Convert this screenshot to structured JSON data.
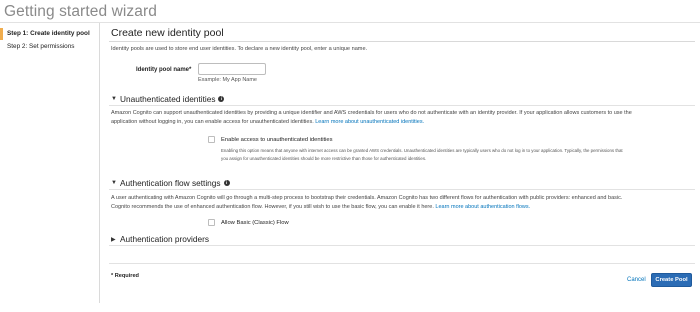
{
  "wizard_title": "Getting started wizard",
  "sidebar": {
    "steps": [
      {
        "label": "Step 1: Create identity pool",
        "active": true
      },
      {
        "label": "Step 2: Set permissions",
        "active": false
      }
    ]
  },
  "main": {
    "title": "Create new identity pool",
    "intro": "Identity pools are used to store end user identities. To declare a new identity pool, enter a unique name.",
    "pool_name": {
      "label": "Identity pool name*",
      "value": "",
      "hint": "Example: My App Name"
    },
    "unauth": {
      "heading": "Unauthenticated identities",
      "desc_line1": "Amazon Cognito can support unauthenticated identities by providing a unique identifier and AWS credentials for users who do not authenticate with an identity provider. If your application allows customers to use the",
      "desc_line2": "application without logging in, you can enable access for unauthenticated identities.",
      "desc_link": "Learn more about unauthenticated identities.",
      "checkbox_label": "Enable access to unauthenticated identities",
      "checkbox_checked": false,
      "checkbox_desc_line1": "Enabling this option means that anyone with internet access can be granted AWS credentials. Unauthenticated identities are typically users who do not log in to your application. Typically, the permissions that",
      "checkbox_desc_line2": "you assign for unauthenticated identities should be more restrictive than those for authenticated identities."
    },
    "auth_flow": {
      "heading": "Authentication flow settings",
      "desc_line1": "A user authenticating with Amazon Cognito will go through a multi-step process to bootstrap their credentials. Amazon Cognito has two different flows for authentication with public providers: enhanced and basic.",
      "desc_line2": "Cognito recommends the use of enhanced authentication flow. However, if you still wish to use the basic flow, you can enable it here.",
      "desc_link": "Learn more about authentication flows.",
      "checkbox_label": "Allow Basic (Classic) Flow",
      "checkbox_checked": false
    },
    "auth_providers": {
      "heading": "Authentication providers"
    },
    "required_note": "* Required",
    "cancel_label": "Cancel",
    "create_label": "Create Pool"
  },
  "colors": {
    "link": "#0073bb",
    "primary_button": "#2b6cb5",
    "active_step_marker": "#f0ad4e"
  }
}
